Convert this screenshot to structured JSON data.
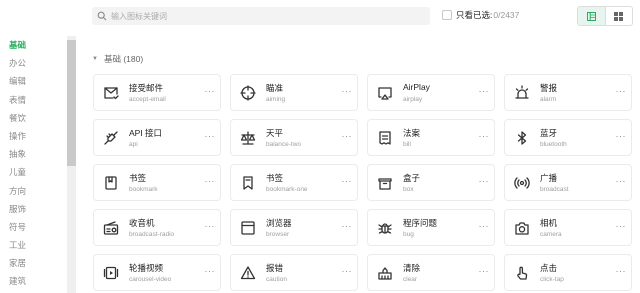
{
  "search": {
    "placeholder": "输入图标关键词"
  },
  "filter": {
    "only_selected_label": "只看已选:",
    "count": "0/2437"
  },
  "view_toggle": {
    "options": [
      "card-view",
      "list-view"
    ],
    "active": "card-view"
  },
  "accent_color": "#27ae60",
  "sidebar": {
    "items": [
      {
        "label": "基础",
        "active": true
      },
      {
        "label": "办公"
      },
      {
        "label": "编辑"
      },
      {
        "label": "表情"
      },
      {
        "label": "餐饮"
      },
      {
        "label": "操作"
      },
      {
        "label": "抽象"
      },
      {
        "label": "儿童"
      },
      {
        "label": "方向"
      },
      {
        "label": "服饰"
      },
      {
        "label": "符号"
      },
      {
        "label": "工业"
      },
      {
        "label": "家居"
      },
      {
        "label": "建筑"
      }
    ]
  },
  "section": {
    "title": "基础 (180)"
  },
  "icons": [
    {
      "cn": "接受邮件",
      "en": "accept-email",
      "icon": "accept-email-icon"
    },
    {
      "cn": "瞄准",
      "en": "aiming",
      "icon": "aiming-icon"
    },
    {
      "cn": "AirPlay",
      "en": "airplay",
      "icon": "airplay-icon"
    },
    {
      "cn": "警报",
      "en": "alarm",
      "icon": "alarm-icon"
    },
    {
      "cn": "API 接口",
      "en": "api",
      "icon": "api-icon"
    },
    {
      "cn": "天平",
      "en": "balance-two",
      "icon": "balance-icon"
    },
    {
      "cn": "法案",
      "en": "bill",
      "icon": "bill-icon"
    },
    {
      "cn": "蓝牙",
      "en": "bluetooth",
      "icon": "bluetooth-icon"
    },
    {
      "cn": "书签",
      "en": "bookmark",
      "icon": "bookmark-icon"
    },
    {
      "cn": "书签",
      "en": "bookmark-one",
      "icon": "bookmark-one-icon"
    },
    {
      "cn": "盒子",
      "en": "box",
      "icon": "box-icon"
    },
    {
      "cn": "广播",
      "en": "broadcast",
      "icon": "broadcast-icon"
    },
    {
      "cn": "收音机",
      "en": "broadcast-radio",
      "icon": "radio-icon"
    },
    {
      "cn": "浏览器",
      "en": "browser",
      "icon": "browser-icon"
    },
    {
      "cn": "程序问题",
      "en": "bug",
      "icon": "bug-icon"
    },
    {
      "cn": "相机",
      "en": "camera",
      "icon": "camera-icon"
    },
    {
      "cn": "轮播视频",
      "en": "carousel-video",
      "icon": "carousel-video-icon"
    },
    {
      "cn": "报错",
      "en": "caution",
      "icon": "caution-icon"
    },
    {
      "cn": "清除",
      "en": "clear",
      "icon": "clear-icon"
    },
    {
      "cn": "点击",
      "en": "click-tap",
      "icon": "click-tap-icon"
    }
  ],
  "more_label": "···"
}
